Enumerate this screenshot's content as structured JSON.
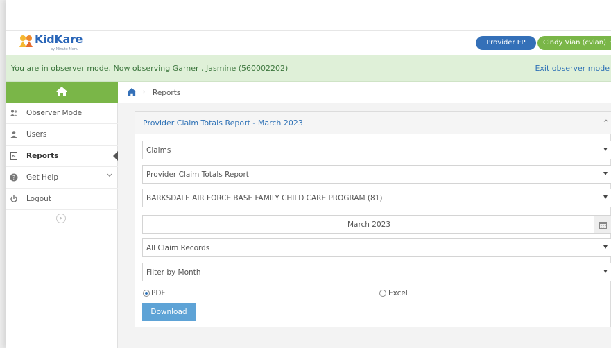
{
  "header": {
    "logo_text": "KidKare",
    "logo_sub": "by Minute Menu",
    "provider_button": "Provider FP",
    "user_button": "Cindy Vian (cvian)"
  },
  "observer": {
    "message": "You are in observer mode. Now observing Garner , Jasmine (560002202)",
    "exit_link": "Exit observer mode"
  },
  "sidebar": {
    "items": [
      {
        "label": "Observer Mode",
        "icon": "users-icon"
      },
      {
        "label": "Users",
        "icon": "user-icon"
      },
      {
        "label": "Reports",
        "icon": "pdf-file-icon",
        "active": true
      },
      {
        "label": "Get Help",
        "icon": "help-icon"
      },
      {
        "label": "Logout",
        "icon": "power-icon"
      }
    ],
    "collapse": "«"
  },
  "breadcrumb": {
    "separator": "›",
    "current": "Reports"
  },
  "panel": {
    "title": "Provider Claim Totals Report - March 2023",
    "caret": "^",
    "selects": {
      "category": "Claims",
      "report": "Provider Claim Totals Report",
      "sponsor": "BARKSDALE AIR FORCE BASE FAMILY CHILD CARE PROGRAM (81)",
      "records": "All Claim Records",
      "filter": "Filter by Month"
    },
    "date": "March 2023",
    "format": {
      "pdf_label": "PDF",
      "excel_label": "Excel",
      "selected": "PDF"
    },
    "download": "Download"
  },
  "colors": {
    "green": "#7ab648",
    "blue": "#3470b8",
    "observer_bg": "#dff0d8",
    "download": "#5ea3d6"
  }
}
